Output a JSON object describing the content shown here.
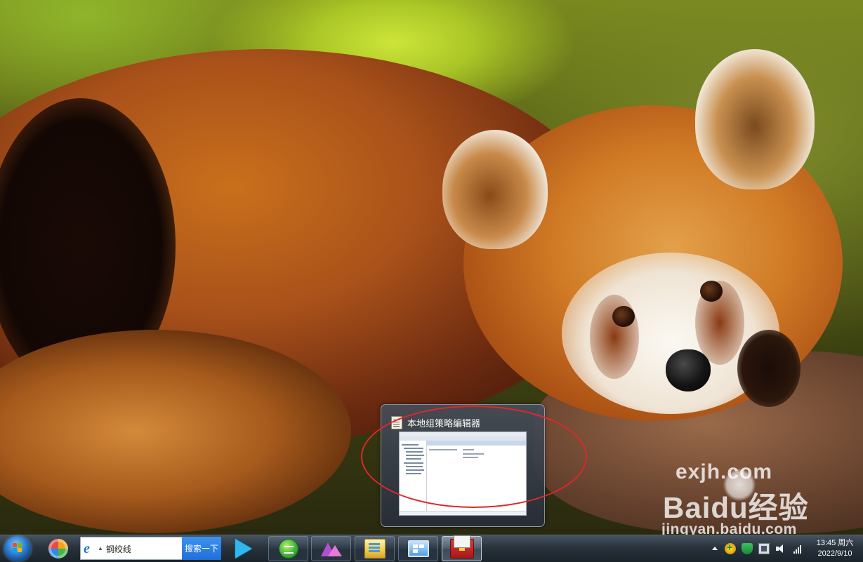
{
  "desktop": {
    "watermark": {
      "line1": "exjh.com",
      "line2": "Baidu经验",
      "line3": "jingyan.baidu.com"
    }
  },
  "thumbnail_preview": {
    "title": "本地组策略编辑器",
    "annotation_color": "#e0282a"
  },
  "taskbar": {
    "search": {
      "value": "钢绞线",
      "button_label": "搜索一下"
    },
    "apps": [
      {
        "icon": "360-icon"
      },
      {
        "icon": "video-player-icon"
      },
      {
        "icon": "browser-icon"
      },
      {
        "icon": "image-viewer-icon"
      },
      {
        "icon": "file-explorer-icon"
      },
      {
        "icon": "control-panel-icon"
      },
      {
        "icon": "group-policy-editor-icon",
        "active": true
      }
    ],
    "tray": {
      "icons": [
        "show-hidden-icons-arrow",
        "360-safe-icon",
        "shield-icon",
        "network-icon",
        "volume-icon",
        "signal-icon"
      ]
    },
    "clock": {
      "time": "13:45",
      "weekday": "周六",
      "date": "2022/9/10"
    }
  },
  "colors": {
    "taskbar": "#222e38",
    "search_button": "#1f6fd8",
    "annotation": "#e0282a"
  }
}
